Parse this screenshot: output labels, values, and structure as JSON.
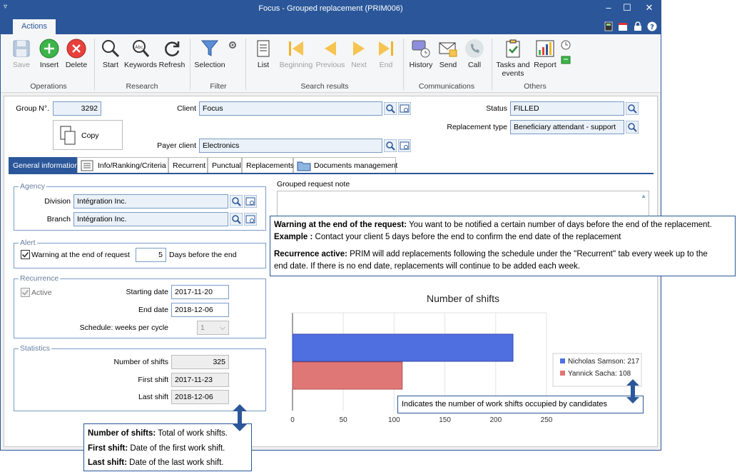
{
  "window": {
    "title": "Focus - Grouped replacement (PRIM006)",
    "ribbon_tab": "Actions"
  },
  "ribbon": {
    "buttons": {
      "save": "Save",
      "insert": "Insert",
      "delete": "Delete",
      "start": "Start",
      "keywords": "Keywords",
      "refresh": "Refresh",
      "selection": "Selection",
      "list": "List",
      "beginning": "Beginning",
      "previous": "Previous",
      "next": "Next",
      "end": "End",
      "history": "History",
      "send": "Send",
      "call": "Call",
      "tasks": "Tasks and events",
      "report": "Report"
    },
    "groups": {
      "operations": "Operations",
      "research": "Research",
      "filter": "Filter",
      "search_results": "Search results",
      "communications": "Communications",
      "others": "Others"
    }
  },
  "header": {
    "group_label": "Group N°.",
    "group_value": "3292",
    "client_label": "Client",
    "client_value": "Focus",
    "payer_label": "Payer client",
    "payer_value": "Electronics",
    "status_label": "Status",
    "status_value": "FILLED",
    "repl_type_label": "Replacement type",
    "repl_type_value": "Beneficiary attendant - support",
    "copy_label": "Copy"
  },
  "tabs": {
    "general": "General information",
    "info": "Info/Ranking/Criteria",
    "recurrent": "Recurrent",
    "punctual": "Punctual",
    "replacements": "Replacements",
    "documents": "Documents management"
  },
  "agency": {
    "title": "Agency",
    "division_label": "Division",
    "division_value": "Intégration Inc.",
    "branch_label": "Branch",
    "branch_value": "Intégration Inc."
  },
  "alert": {
    "title": "Alert",
    "warning_label": "Warning at the end of request",
    "days_value": "5",
    "days_label": "Days before the end"
  },
  "recurrence": {
    "title": "Recurrence",
    "active_label": "Active",
    "start_label": "Starting date",
    "start_value": "2017-11-20",
    "end_label": "End date",
    "end_value": "2018-12-06",
    "schedule_label": "Schedule: weeks per cycle",
    "schedule_value": "1"
  },
  "statistics": {
    "title": "Statistics",
    "shifts_label": "Number of shifts",
    "shifts_value": "325",
    "first_label": "First shift",
    "first_value": "2017-11-23",
    "last_label": "Last shift",
    "last_value": "2018-12-06"
  },
  "note": {
    "title": "Grouped request note"
  },
  "chart_data": {
    "type": "bar",
    "orientation": "horizontal",
    "title": "Number of shifts",
    "series": [
      {
        "name": "Nicholas Samson",
        "value": 217,
        "legend": "Nicholas Samson: 217",
        "color": "#4f6fe0"
      },
      {
        "name": "Yannick Sacha",
        "value": 108,
        "legend": "Yannick Sacha: 108",
        "color": "#e07777"
      }
    ],
    "xlim": [
      0,
      250
    ],
    "xticks": [
      "0",
      "50",
      "100",
      "150",
      "200",
      "250"
    ],
    "grid": true,
    "legend_position": "right"
  },
  "callouts": {
    "warning_bold": "Warning at the end of the request:",
    "warning_text": " You want to be notified a certain number of days before the end of the replacement.",
    "example_bold": "Example :",
    "example_text": " Contact your client 5 days before the end to confirm the end date of the replacement",
    "recurrence_bold": "Recurrence active:",
    "recurrence_text1": " PRIM will add replacements following the schedule under the ''Recurrent'' tab every week up to the",
    "recurrence_text2": "end date. If there is no end date, replacements will continue to be added each week.",
    "chart_note": "Indicates the number of work shifts occupied by candidates",
    "shifts_bold": "Number of shifts:",
    "shifts_text": " Total of work shifts.",
    "first_bold": "First shift:",
    "first_text": " Date of the first work shift.",
    "last_bold": "Last shift:",
    "last_text": " Date of the last work shift."
  },
  "colors": {
    "accent": "#2b579a",
    "insert_green": "#3cb44a",
    "delete_red": "#e8403a"
  }
}
